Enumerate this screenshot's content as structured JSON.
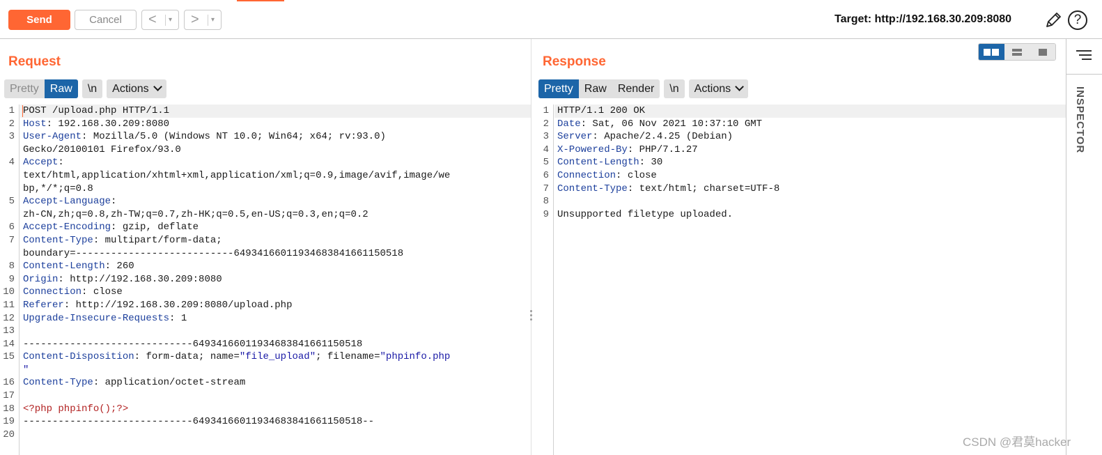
{
  "toolbar": {
    "send_label": "Send",
    "cancel_label": "Cancel",
    "back_arrow": "<",
    "forward_arrow": ">",
    "dropdown_glyph": "▾",
    "target_label": "Target: http://192.168.30.209:8080",
    "help_glyph": "?"
  },
  "request": {
    "title": "Request",
    "tabs": {
      "pretty": "Pretty",
      "raw": "Raw",
      "newline": "\\n",
      "actions": "Actions"
    },
    "active_tab": "Raw",
    "lines": [
      {
        "n": "1",
        "rows": [
          [
            {
              "t": "POST /upload.php HTTP/1.1"
            }
          ]
        ]
      },
      {
        "n": "2",
        "rows": [
          [
            {
              "t": "Host",
              "c": "hdr"
            },
            {
              "t": ": 192.168.30.209:8080"
            }
          ]
        ]
      },
      {
        "n": "3",
        "rows": [
          [
            {
              "t": "User-Agent",
              "c": "hdr"
            },
            {
              "t": ": Mozilla/5.0 (Windows NT 10.0; Win64; x64; rv:93.0)"
            }
          ],
          [
            {
              "t": "Gecko/20100101 Firefox/93.0"
            }
          ]
        ]
      },
      {
        "n": "4",
        "rows": [
          [
            {
              "t": "Accept",
              "c": "hdr"
            },
            {
              "t": ":"
            }
          ],
          [
            {
              "t": "text/html,application/xhtml+xml,application/xml;q=0.9,image/avif,image/we"
            }
          ],
          [
            {
              "t": "bp,*/*;q=0.8"
            }
          ]
        ]
      },
      {
        "n": "5",
        "rows": [
          [
            {
              "t": "Accept-Language",
              "c": "hdr"
            },
            {
              "t": ":"
            }
          ],
          [
            {
              "t": "zh-CN,zh;q=0.8,zh-TW;q=0.7,zh-HK;q=0.5,en-US;q=0.3,en;q=0.2"
            }
          ]
        ]
      },
      {
        "n": "6",
        "rows": [
          [
            {
              "t": "Accept-Encoding",
              "c": "hdr"
            },
            {
              "t": ": gzip, deflate"
            }
          ]
        ]
      },
      {
        "n": "7",
        "rows": [
          [
            {
              "t": "Content-Type",
              "c": "hdr"
            },
            {
              "t": ": multipart/form-data;"
            }
          ],
          [
            {
              "t": "boundary=---------------------------64934166011934683841661150518"
            }
          ]
        ]
      },
      {
        "n": "8",
        "rows": [
          [
            {
              "t": "Content-Length",
              "c": "hdr"
            },
            {
              "t": ": 260"
            }
          ]
        ]
      },
      {
        "n": "9",
        "rows": [
          [
            {
              "t": "Origin",
              "c": "hdr"
            },
            {
              "t": ": http://192.168.30.209:8080"
            }
          ]
        ]
      },
      {
        "n": "10",
        "rows": [
          [
            {
              "t": "Connection",
              "c": "hdr"
            },
            {
              "t": ": close"
            }
          ]
        ]
      },
      {
        "n": "11",
        "rows": [
          [
            {
              "t": "Referer",
              "c": "hdr"
            },
            {
              "t": ": http://192.168.30.209:8080/upload.php"
            }
          ]
        ]
      },
      {
        "n": "12",
        "rows": [
          [
            {
              "t": "Upgrade-Insecure-Requests",
              "c": "hdr"
            },
            {
              "t": ": 1"
            }
          ]
        ]
      },
      {
        "n": "13",
        "rows": [
          [
            {
              "t": ""
            }
          ]
        ]
      },
      {
        "n": "14",
        "rows": [
          [
            {
              "t": "-----------------------------64934166011934683841661150518"
            }
          ]
        ]
      },
      {
        "n": "15",
        "rows": [
          [
            {
              "t": "Content-Disposition",
              "c": "hdr"
            },
            {
              "t": ": form-data; name="
            },
            {
              "t": "\"file_upload\"",
              "c": "str"
            },
            {
              "t": "; filename="
            },
            {
              "t": "\"phpinfo.php",
              "c": "str"
            }
          ],
          [
            {
              "t": "\"",
              "c": "str"
            }
          ]
        ]
      },
      {
        "n": "16",
        "rows": [
          [
            {
              "t": "Content-Type",
              "c": "hdr"
            },
            {
              "t": ": application/octet-stream"
            }
          ]
        ]
      },
      {
        "n": "17",
        "rows": [
          [
            {
              "t": ""
            }
          ]
        ]
      },
      {
        "n": "18",
        "rows": [
          [
            {
              "t": "<?php phpinfo();?>",
              "c": "php"
            }
          ]
        ]
      },
      {
        "n": "19",
        "rows": [
          [
            {
              "t": "-----------------------------64934166011934683841661150518--"
            }
          ]
        ]
      },
      {
        "n": "20",
        "rows": [
          [
            {
              "t": ""
            }
          ]
        ]
      }
    ]
  },
  "response": {
    "title": "Response",
    "tabs": {
      "pretty": "Pretty",
      "raw": "Raw",
      "render": "Render",
      "newline": "\\n",
      "actions": "Actions"
    },
    "active_tab": "Pretty",
    "lines": [
      {
        "n": "1",
        "rows": [
          [
            {
              "t": "HTTP/1.1 200 OK"
            }
          ]
        ]
      },
      {
        "n": "2",
        "rows": [
          [
            {
              "t": "Date",
              "c": "hdr"
            },
            {
              "t": ": Sat, 06 Nov 2021 10:37:10 GMT"
            }
          ]
        ]
      },
      {
        "n": "3",
        "rows": [
          [
            {
              "t": "Server",
              "c": "hdr"
            },
            {
              "t": ": Apache/2.4.25 (Debian)"
            }
          ]
        ]
      },
      {
        "n": "4",
        "rows": [
          [
            {
              "t": "X-Powered-By",
              "c": "hdr"
            },
            {
              "t": ": PHP/7.1.27"
            }
          ]
        ]
      },
      {
        "n": "5",
        "rows": [
          [
            {
              "t": "Content-Length",
              "c": "hdr"
            },
            {
              "t": ": 30"
            }
          ]
        ]
      },
      {
        "n": "6",
        "rows": [
          [
            {
              "t": "Connection",
              "c": "hdr"
            },
            {
              "t": ": close"
            }
          ]
        ]
      },
      {
        "n": "7",
        "rows": [
          [
            {
              "t": "Content-Type",
              "c": "hdr"
            },
            {
              "t": ": text/html; charset=UTF-8"
            }
          ]
        ]
      },
      {
        "n": "8",
        "rows": [
          [
            {
              "t": ""
            }
          ]
        ]
      },
      {
        "n": "9",
        "rows": [
          [
            {
              "t": "Unsupported filetype uploaded."
            }
          ]
        ]
      }
    ]
  },
  "inspector": {
    "label": "INSPECTOR"
  },
  "watermark": "CSDN @君莫hacker",
  "colors": {
    "accent": "#ff6633",
    "active_tab": "#1c65a8",
    "header_name": "#1c3f9c",
    "string": "#1a1aa6",
    "php": "#b22222"
  }
}
